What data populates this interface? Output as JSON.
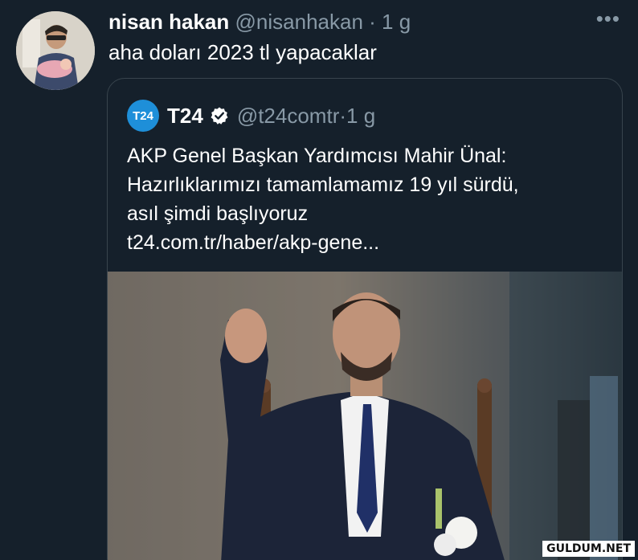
{
  "tweet": {
    "author_name": "nisan hakan",
    "author_handle": "@nisanhakan",
    "separator": "·",
    "time": "1 g",
    "text": "aha doları 2023 tl yapacaklar",
    "more_icon": "more-icon"
  },
  "quoted": {
    "logo_text": "T24",
    "name": "T24",
    "handle": "@t24comtr",
    "separator": "·",
    "time": "1 g",
    "verified_icon": "verified-icon",
    "lines": [
      "AKP Genel Başkan Yardımcısı Mahir Ünal:",
      "Hazırlıklarımızı tamamlamamız 19 yıl sürdü,",
      "asıl şimdi başlıyoruz"
    ],
    "link": "t24.com.tr/haber/akp-gene..."
  },
  "watermark": "GULDUM.NET",
  "colors": {
    "background": "#15202b",
    "secondary_text": "#8899a6",
    "border": "#38444d",
    "verified": "#ffffff",
    "t24_logo": "#1e8fd9"
  }
}
